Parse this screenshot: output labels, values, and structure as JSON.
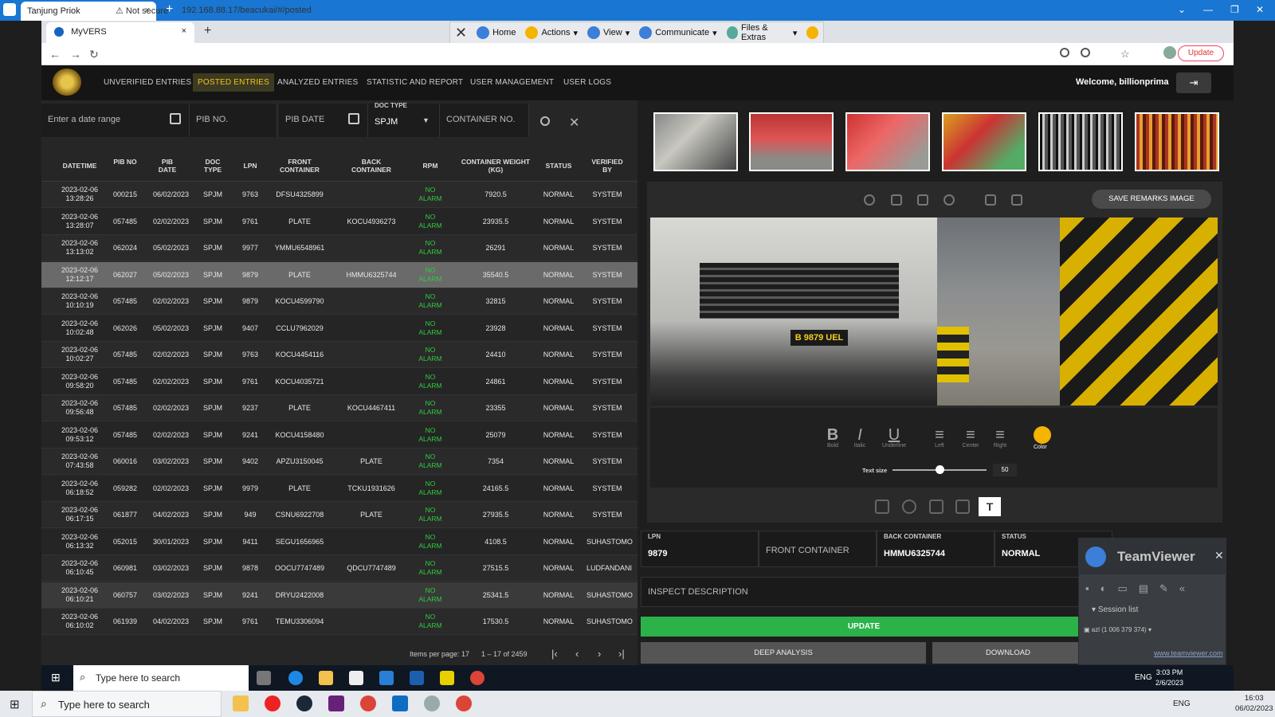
{
  "outer_window": {
    "tab_title": "Tanjung Priok",
    "close": "×",
    "new_tab": "+",
    "minimize": "—",
    "restore": "❐",
    "close_btn": "✕"
  },
  "inner_browser": {
    "tab_title": "MyVERS",
    "close": "×",
    "new_tab": "+",
    "back": "←",
    "forward": "→",
    "reload": "↻",
    "not_secure": "⚠ Not secure",
    "url": "192.168.88.17/beacukai/#/posted",
    "update_label": "Update"
  },
  "teamviewer_toolbar": {
    "close": "✕",
    "home": "Home",
    "actions": "Actions",
    "view": "View",
    "communicate": "Communicate",
    "files": "Files & Extras"
  },
  "nav": {
    "items": [
      "UNVERIFIED ENTRIES",
      "POSTED ENTRIES",
      "ANALYZED ENTRIES",
      "STATISTIC AND REPORT",
      "USER MANAGEMENT",
      "USER LOGS"
    ],
    "active": "POSTED ENTRIES",
    "welcome": "Welcome, billionprima"
  },
  "filters": {
    "date_range_placeholder": "Enter a date range",
    "pib_no_placeholder": "PIB NO.",
    "pib_date_placeholder": "PIB DATE",
    "doc_type_label": "DOC TYPE",
    "doc_type_value": "SPJM",
    "container_placeholder": "CONTAINER NO."
  },
  "table": {
    "headers": [
      "DATETIME",
      "PIB NO",
      "PIB DATE",
      "DOC TYPE",
      "LPN",
      "FRONT CONTAINER",
      "BACK CONTAINER",
      "RPM",
      "CONTAINER WEIGHT (KG)",
      "STATUS",
      "VERIFIED BY"
    ],
    "rows": [
      [
        "2023-02-06 13:28:26",
        "000215",
        "06/02/2023",
        "SPJM",
        "9763",
        "DFSU4325899",
        "",
        "NO ALARM",
        "7920.5",
        "NORMAL",
        "SYSTEM"
      ],
      [
        "2023-02-06 13:28:07",
        "057485",
        "02/02/2023",
        "SPJM",
        "9761",
        "PLATE",
        "KOCU4936273",
        "NO ALARM",
        "23935.5",
        "NORMAL",
        "SYSTEM"
      ],
      [
        "2023-02-06 13:13:02",
        "062024",
        "05/02/2023",
        "SPJM",
        "9977",
        "YMMU6548961",
        "",
        "NO ALARM",
        "26291",
        "NORMAL",
        "SYSTEM"
      ],
      [
        "2023-02-06 12:12:17",
        "062027",
        "05/02/2023",
        "SPJM",
        "9879",
        "PLATE",
        "HMMU6325744",
        "NO ALARM",
        "35540.5",
        "NORMAL",
        "SYSTEM"
      ],
      [
        "2023-02-06 10:10:19",
        "057485",
        "02/02/2023",
        "SPJM",
        "9879",
        "KOCU4599790",
        "",
        "NO ALARM",
        "32815",
        "NORMAL",
        "SYSTEM"
      ],
      [
        "2023-02-06 10:02:48",
        "062026",
        "05/02/2023",
        "SPJM",
        "9407",
        "CCLU7962029",
        "",
        "NO ALARM",
        "23928",
        "NORMAL",
        "SYSTEM"
      ],
      [
        "2023-02-06 10:02:27",
        "057485",
        "02/02/2023",
        "SPJM",
        "9763",
        "KOCU4454116",
        "",
        "NO ALARM",
        "24410",
        "NORMAL",
        "SYSTEM"
      ],
      [
        "2023-02-06 09:58:20",
        "057485",
        "02/02/2023",
        "SPJM",
        "9761",
        "KOCU4035721",
        "",
        "NO ALARM",
        "24861",
        "NORMAL",
        "SYSTEM"
      ],
      [
        "2023-02-06 09:56:48",
        "057485",
        "02/02/2023",
        "SPJM",
        "9237",
        "PLATE",
        "KOCU4467411",
        "NO ALARM",
        "23355",
        "NORMAL",
        "SYSTEM"
      ],
      [
        "2023-02-06 09:53:12",
        "057485",
        "02/02/2023",
        "SPJM",
        "9241",
        "KOCU4158480",
        "",
        "NO ALARM",
        "25079",
        "NORMAL",
        "SYSTEM"
      ],
      [
        "2023-02-06 07:43:58",
        "060016",
        "03/02/2023",
        "SPJM",
        "9402",
        "APZU3150045",
        "PLATE",
        "NO ALARM",
        "7354",
        "NORMAL",
        "SYSTEM"
      ],
      [
        "2023-02-06 06:18:52",
        "059282",
        "02/02/2023",
        "SPJM",
        "9979",
        "PLATE",
        "TCKU1931626",
        "NO ALARM",
        "24165.5",
        "NORMAL",
        "SYSTEM"
      ],
      [
        "2023-02-06 06:17:15",
        "061877",
        "04/02/2023",
        "SPJM",
        "949",
        "CSNU6922708",
        "PLATE",
        "NO ALARM",
        "27935.5",
        "NORMAL",
        "SYSTEM"
      ],
      [
        "2023-02-06 06:13:32",
        "052015",
        "30/01/2023",
        "SPJM",
        "9411",
        "SEGU1656965",
        "",
        "NO ALARM",
        "4108.5",
        "NORMAL",
        "SUHASTOMO"
      ],
      [
        "2023-02-06 06:10:45",
        "060981",
        "03/02/2023",
        "SPJM",
        "9878",
        "OOCU7747489",
        "QDCU7747489",
        "NO ALARM",
        "27515.5",
        "NORMAL",
        "LUDFANDANI"
      ],
      [
        "2023-02-06 06:10:21",
        "060757",
        "03/02/2023",
        "SPJM",
        "9241",
        "DRYU2422008",
        "",
        "NO ALARM",
        "25341.5",
        "NORMAL",
        "SUHASTOMO"
      ],
      [
        "2023-02-06 06:10:02",
        "061939",
        "04/02/2023",
        "SPJM",
        "9761",
        "TEMU3306094",
        "",
        "NO ALARM",
        "17530.5",
        "NORMAL",
        "SUHASTOMO"
      ]
    ]
  },
  "pager": {
    "items_per_page": "Items per page: 17",
    "range": "1 – 17 of 2459",
    "first": "|‹",
    "prev": "‹",
    "next": "›",
    "last": "›|"
  },
  "viewer": {
    "save_remarks": "SAVE REMARKS IMAGE",
    "plate_text": "B 9879 UEL",
    "text_tools": {
      "bold": "Bold",
      "italic": "Italic",
      "underline": "Underline",
      "left": "Left",
      "center": "Center",
      "right": "Right",
      "color": "Color"
    },
    "text_size_label": "Text size",
    "text_size_value": "50",
    "text_size_fraction": 0.5
  },
  "form": {
    "lpn_label": "LPN",
    "lpn_value": "9879",
    "front_container_placeholder": "FRONT CONTAINER",
    "back_container_label": "BACK CONTAINER",
    "back_container_value": "HMMU6325744",
    "status_label": "STATUS",
    "status_value": "NORMAL",
    "inspect_placeholder": "INSPECT DESCRIPTION",
    "update": "UPDATE",
    "deep_analysis": "DEEP ANALYSIS",
    "download": "DOWNLOAD"
  },
  "teamviewer_panel": {
    "title": "TeamViewer",
    "close": "✕",
    "session_list": "Session list",
    "user": "azl (1 006 379 374)",
    "url": "www.teamviewer.com"
  },
  "inner_taskbar": {
    "search": "Type here to search",
    "lang": "ENG",
    "time": "3:03 PM",
    "date": "2/6/2023"
  },
  "outer_taskbar": {
    "search": "Type here to search",
    "lang": "ENG",
    "time": "16:03",
    "date": "06/02/2023"
  }
}
